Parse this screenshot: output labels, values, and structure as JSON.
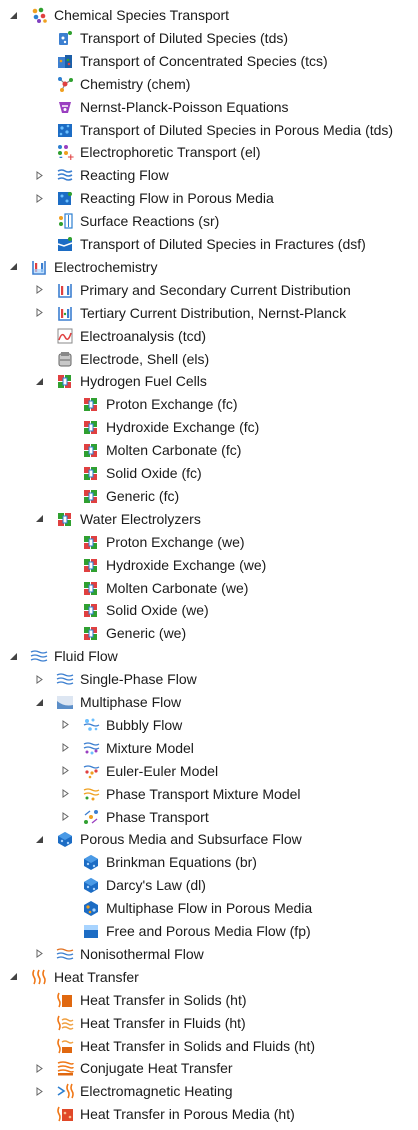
{
  "tree": [
    {
      "label": "Chemical Species Transport",
      "level": 0,
      "state": "expanded",
      "icon": "chemical-species-icon"
    },
    {
      "label": "Transport of Diluted Species (tds)",
      "level": 1,
      "state": "leaf",
      "icon": "diluted-species-icon"
    },
    {
      "label": "Transport of Concentrated Species (tcs)",
      "level": 1,
      "state": "leaf",
      "icon": "concentrated-species-icon"
    },
    {
      "label": "Chemistry (chem)",
      "level": 1,
      "state": "leaf",
      "icon": "chemistry-icon"
    },
    {
      "label": "Nernst-Planck-Poisson Equations",
      "level": 1,
      "state": "leaf",
      "icon": "nernst-planck-icon"
    },
    {
      "label": "Transport of Diluted Species in Porous Media (tds)",
      "level": 1,
      "state": "leaf",
      "icon": "porous-media-species-icon"
    },
    {
      "label": "Electrophoretic Transport (el)",
      "level": 1,
      "state": "leaf",
      "icon": "electrophoretic-icon"
    },
    {
      "label": "Reacting Flow",
      "level": 1,
      "state": "collapsed",
      "icon": "reacting-flow-icon"
    },
    {
      "label": "Reacting Flow in Porous Media",
      "level": 1,
      "state": "collapsed",
      "icon": "reacting-flow-porous-icon"
    },
    {
      "label": "Surface Reactions (sr)",
      "level": 1,
      "state": "leaf",
      "icon": "surface-reactions-icon"
    },
    {
      "label": "Transport of Diluted Species in Fractures (dsf)",
      "level": 1,
      "state": "leaf",
      "icon": "fractures-species-icon"
    },
    {
      "label": "Electrochemistry",
      "level": 0,
      "state": "expanded",
      "icon": "electrochemistry-icon"
    },
    {
      "label": "Primary and Secondary Current Distribution",
      "level": 1,
      "state": "collapsed",
      "icon": "current-distribution-icon"
    },
    {
      "label": "Tertiary Current Distribution, Nernst-Planck",
      "level": 1,
      "state": "collapsed",
      "icon": "tertiary-current-icon"
    },
    {
      "label": "Electroanalysis (tcd)",
      "level": 1,
      "state": "leaf",
      "icon": "electroanalysis-icon"
    },
    {
      "label": "Electrode, Shell (els)",
      "level": 1,
      "state": "leaf",
      "icon": "electrode-shell-icon"
    },
    {
      "label": "Hydrogen Fuel Cells",
      "level": 1,
      "state": "expanded",
      "icon": "fuel-cell-icon"
    },
    {
      "label": "Proton Exchange (fc)",
      "level": 2,
      "state": "leaf",
      "icon": "fuel-cell-icon"
    },
    {
      "label": "Hydroxide Exchange (fc)",
      "level": 2,
      "state": "leaf",
      "icon": "fuel-cell-icon"
    },
    {
      "label": "Molten Carbonate (fc)",
      "level": 2,
      "state": "leaf",
      "icon": "fuel-cell-icon"
    },
    {
      "label": "Solid Oxide (fc)",
      "level": 2,
      "state": "leaf",
      "icon": "fuel-cell-icon"
    },
    {
      "label": "Generic (fc)",
      "level": 2,
      "state": "leaf",
      "icon": "fuel-cell-icon"
    },
    {
      "label": "Water Electrolyzers",
      "level": 1,
      "state": "expanded",
      "icon": "electrolyzer-icon"
    },
    {
      "label": "Proton Exchange (we)",
      "level": 2,
      "state": "leaf",
      "icon": "electrolyzer-icon"
    },
    {
      "label": "Hydroxide Exchange (we)",
      "level": 2,
      "state": "leaf",
      "icon": "electrolyzer-icon"
    },
    {
      "label": "Molten Carbonate (we)",
      "level": 2,
      "state": "leaf",
      "icon": "electrolyzer-icon"
    },
    {
      "label": "Solid Oxide (we)",
      "level": 2,
      "state": "leaf",
      "icon": "electrolyzer-icon"
    },
    {
      "label": "Generic (we)",
      "level": 2,
      "state": "leaf",
      "icon": "electrolyzer-icon"
    },
    {
      "label": "Fluid Flow",
      "level": 0,
      "state": "expanded",
      "icon": "fluid-flow-icon"
    },
    {
      "label": "Single-Phase Flow",
      "level": 1,
      "state": "collapsed",
      "icon": "fluid-flow-icon"
    },
    {
      "label": "Multiphase Flow",
      "level": 1,
      "state": "expanded",
      "icon": "multiphase-flow-icon"
    },
    {
      "label": "Bubbly Flow",
      "level": 2,
      "state": "collapsed",
      "icon": "bubbly-flow-icon"
    },
    {
      "label": "Mixture Model",
      "level": 2,
      "state": "collapsed",
      "icon": "mixture-model-icon"
    },
    {
      "label": "Euler-Euler Model",
      "level": 2,
      "state": "collapsed",
      "icon": "euler-euler-icon"
    },
    {
      "label": "Phase Transport Mixture Model",
      "level": 2,
      "state": "collapsed",
      "icon": "phase-transport-mixture-icon"
    },
    {
      "label": "Phase Transport",
      "level": 2,
      "state": "collapsed",
      "icon": "phase-transport-icon"
    },
    {
      "label": "Porous Media and Subsurface Flow",
      "level": 1,
      "state": "expanded",
      "icon": "porous-media-icon"
    },
    {
      "label": "Brinkman Equations (br)",
      "level": 2,
      "state": "leaf",
      "icon": "porous-media-icon"
    },
    {
      "label": "Darcy's Law (dl)",
      "level": 2,
      "state": "leaf",
      "icon": "porous-media-icon"
    },
    {
      "label": "Multiphase Flow in Porous Media",
      "level": 2,
      "state": "leaf",
      "icon": "multiphase-porous-icon"
    },
    {
      "label": "Free and Porous Media Flow (fp)",
      "level": 2,
      "state": "leaf",
      "icon": "free-porous-flow-icon"
    },
    {
      "label": "Nonisothermal Flow",
      "level": 1,
      "state": "collapsed",
      "icon": "nonisothermal-flow-icon"
    },
    {
      "label": "Heat Transfer",
      "level": 0,
      "state": "expanded",
      "icon": "heat-transfer-icon"
    },
    {
      "label": "Heat Transfer in Solids (ht)",
      "level": 1,
      "state": "leaf",
      "icon": "heat-solids-icon"
    },
    {
      "label": "Heat Transfer in Fluids (ht)",
      "level": 1,
      "state": "leaf",
      "icon": "heat-fluids-icon"
    },
    {
      "label": "Heat Transfer in Solids and Fluids (ht)",
      "level": 1,
      "state": "leaf",
      "icon": "heat-solids-fluids-icon"
    },
    {
      "label": "Conjugate Heat Transfer",
      "level": 1,
      "state": "collapsed",
      "icon": "conjugate-heat-icon"
    },
    {
      "label": "Electromagnetic Heating",
      "level": 1,
      "state": "collapsed",
      "icon": "electromagnetic-heating-icon"
    },
    {
      "label": "Heat Transfer in Porous Media (ht)",
      "level": 1,
      "state": "leaf",
      "icon": "heat-porous-icon"
    }
  ]
}
